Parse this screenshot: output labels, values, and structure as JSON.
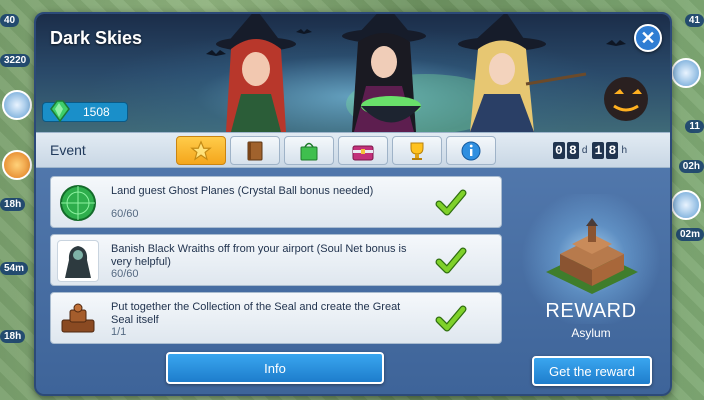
{
  "event": {
    "title": "Dark Skies",
    "gems": "1508",
    "tab_label": "Event",
    "timer": {
      "days_digits": [
        "0",
        "8"
      ],
      "days_unit": "d",
      "hours_digits": [
        "1",
        "8"
      ],
      "hours_unit": "h"
    },
    "tabs": [
      {
        "icon": "star-icon",
        "active": true
      },
      {
        "icon": "book-icon",
        "active": false
      },
      {
        "icon": "shopping-bag-icon",
        "active": false
      },
      {
        "icon": "chest-icon",
        "active": false
      },
      {
        "icon": "trophy-icon",
        "active": false
      },
      {
        "icon": "info-icon",
        "active": false
      }
    ]
  },
  "tasks": [
    {
      "text": "Land guest Ghost Planes (Crystal Ball bonus needed)",
      "progress": "60/60",
      "icon": "crystal-ball-icon",
      "completed": true
    },
    {
      "text": "Banish Black Wraiths off from your airport (Soul Net bonus is very helpful)",
      "progress": "60/60",
      "icon": "wraith-icon",
      "completed": true
    },
    {
      "text": "Put together the Collection of the Seal and create the Great Seal itself",
      "progress": "1/1",
      "icon": "seal-icon",
      "completed": true
    }
  ],
  "buttons": {
    "info": "Info",
    "get_reward": "Get the reward"
  },
  "reward": {
    "title": "REWARD",
    "name": "Asylum"
  },
  "background": {
    "left_badges": [
      "40",
      "3220",
      "18h",
      "54m",
      "18h"
    ],
    "right_badges": [
      "41",
      "11",
      "02h",
      "02m"
    ]
  },
  "colors": {
    "accent": "#1e7dcc",
    "check": "#6cc21d",
    "dialog": "#4a72a8"
  }
}
